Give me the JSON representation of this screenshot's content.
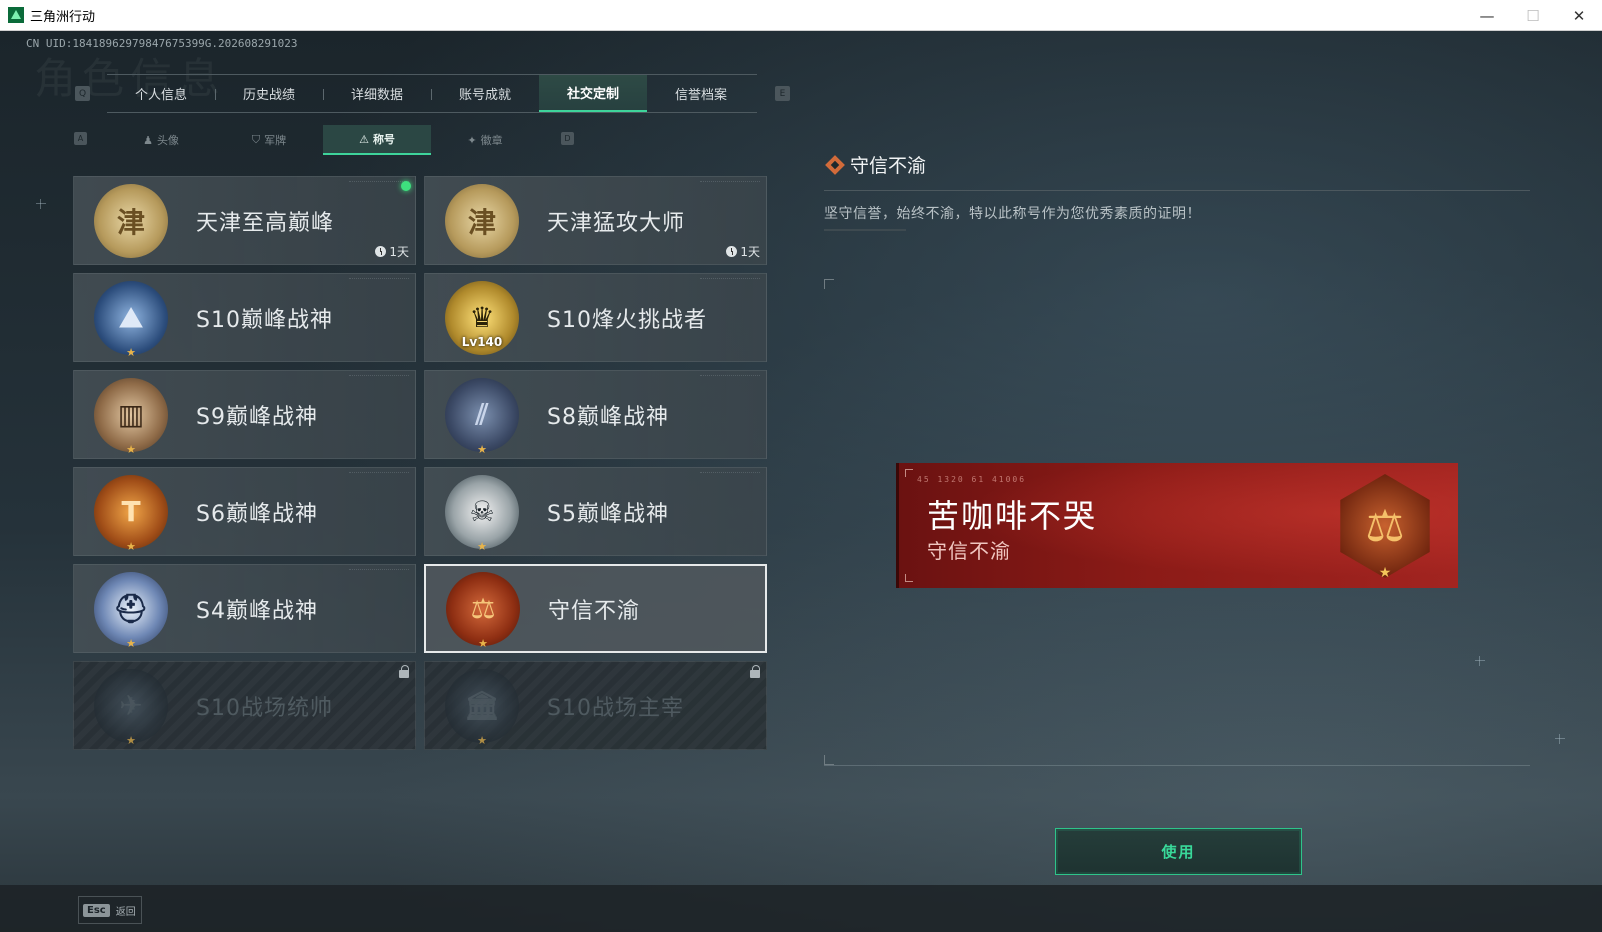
{
  "window": {
    "title": "三角洲行动",
    "minimize": "—",
    "maximize": "☐",
    "close": "✕"
  },
  "uid": "CN UID:18418962979847675399G.202608291023",
  "watermark": "角色信息",
  "keys": {
    "prev_tab": "Q",
    "next_tab": "E",
    "prev_sub": "A",
    "next_sub": "D"
  },
  "main_tabs": [
    {
      "label": "个人信息"
    },
    {
      "label": "历史战绩"
    },
    {
      "label": "详细数据"
    },
    {
      "label": "账号成就"
    },
    {
      "label": "社交定制",
      "active": true
    },
    {
      "label": "信誉档案"
    }
  ],
  "sub_tabs": [
    {
      "label": "头像",
      "icon": "person-icon",
      "glyph": "♟"
    },
    {
      "label": "军牌",
      "icon": "dogtag-icon",
      "glyph": "⛉"
    },
    {
      "label": "称号",
      "icon": "triangle-icon",
      "glyph": "⚠",
      "active": true
    },
    {
      "label": "徽章",
      "icon": "emblem-icon",
      "glyph": "✦"
    }
  ],
  "titles": [
    {
      "label": "天津至高巅峰",
      "badge": "gold",
      "glyph": "津",
      "timer": "1天",
      "equipped": true
    },
    {
      "label": "天津猛攻大师",
      "badge": "gold",
      "glyph": "津",
      "timer": "1天"
    },
    {
      "label": "S10巅峰战神",
      "badge": "blue",
      "glyph": "⛰"
    },
    {
      "label": "S10烽火挑战者",
      "badge": "goldmask",
      "glyph": "♛",
      "level": "Lv140"
    },
    {
      "label": "S9巅峰战神",
      "badge": "bronze",
      "glyph": "▥"
    },
    {
      "label": "S8巅峰战神",
      "badge": "steel",
      "glyph": "⫽"
    },
    {
      "label": "S6巅峰战神",
      "badge": "copper",
      "glyph": "T"
    },
    {
      "label": "S5巅峰战神",
      "badge": "skull",
      "glyph": "☠"
    },
    {
      "label": "S4巅峰战神",
      "badge": "helmet",
      "glyph": "⛑"
    },
    {
      "label": "守信不渝",
      "badge": "justice",
      "glyph": "⚖",
      "selected": true
    },
    {
      "label": "S10战场统帅",
      "badge": "dark",
      "glyph": "✈",
      "locked": true
    },
    {
      "label": "S10战场主宰",
      "badge": "dark",
      "glyph": "🏛",
      "locked": true
    }
  ],
  "detail": {
    "title": "守信不渝",
    "description": "坚守信誉，始终不渝，特以此称号作为您优秀素质的证明！"
  },
  "nameplate": {
    "code": "45 1320  61 41006",
    "player_name": "苦咖啡不哭",
    "title": "守信不渝",
    "glyph": "⚖"
  },
  "use_button": "使用",
  "back": {
    "key": "Esc",
    "label": "返回"
  },
  "colors": {
    "accent": "#3ed49b",
    "nameplate_red": "#8c1b17",
    "equipped_dot": "#3ee07e"
  }
}
